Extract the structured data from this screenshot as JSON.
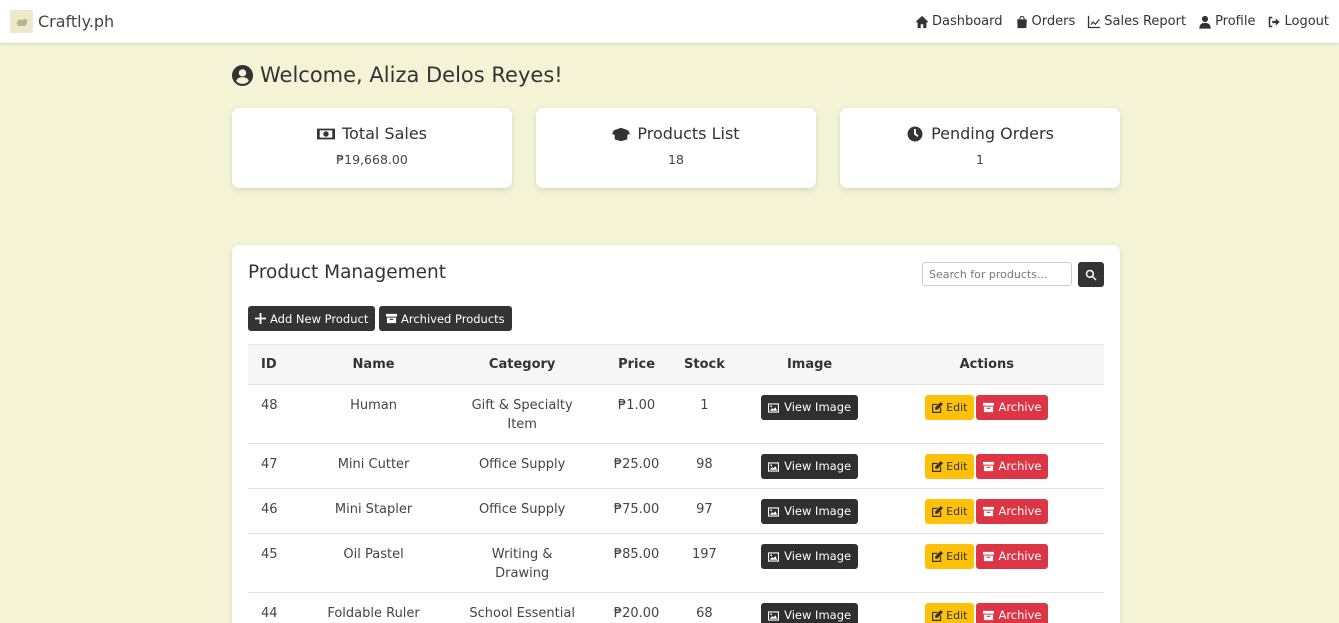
{
  "brand": {
    "name": "Craftly.ph"
  },
  "nav": [
    {
      "label": "Dashboard",
      "icon": "home-icon"
    },
    {
      "label": "Orders",
      "icon": "shopping-bag-icon"
    },
    {
      "label": "Sales Report",
      "icon": "line-chart-icon"
    },
    {
      "label": "Profile",
      "icon": "user-icon"
    },
    {
      "label": "Logout",
      "icon": "logout-icon"
    }
  ],
  "welcome": {
    "text": "Welcome, Aliza Delos Reyes!"
  },
  "stats": [
    {
      "title": "Total Sales",
      "value": "₱19,668.00",
      "icon": "money-icon"
    },
    {
      "title": "Products List",
      "value": "18",
      "icon": "box-open-icon"
    },
    {
      "title": "Pending Orders",
      "value": "1",
      "icon": "clock-icon"
    }
  ],
  "products": {
    "title": "Product Management",
    "search_placeholder": "Search for products...",
    "add_label": "Add New Product",
    "archived_label": "Archived Products",
    "columns": [
      "ID",
      "Name",
      "Category",
      "Price",
      "Stock",
      "Image",
      "Actions"
    ],
    "view_label": "View Image",
    "edit_label": "Edit",
    "archive_label": "Archive",
    "rows": [
      {
        "id": "48",
        "name": "Human",
        "category": "Gift & Specialty Item",
        "price": "₱1.00",
        "stock": "1"
      },
      {
        "id": "47",
        "name": "Mini Cutter",
        "category": "Office Supply",
        "price": "₱25.00",
        "stock": "98"
      },
      {
        "id": "46",
        "name": "Mini Stapler",
        "category": "Office Supply",
        "price": "₱75.00",
        "stock": "97"
      },
      {
        "id": "45",
        "name": "Oil Pastel",
        "category": "Writing & Drawing",
        "price": "₱85.00",
        "stock": "197"
      },
      {
        "id": "44",
        "name": "Foldable Ruler",
        "category": "School Essential",
        "price": "₱20.00",
        "stock": "68"
      }
    ]
  },
  "colors": {
    "background": "#f4f3d6",
    "dark_button": "#343434",
    "edit": "#ffc107",
    "archive": "#dc3545"
  }
}
